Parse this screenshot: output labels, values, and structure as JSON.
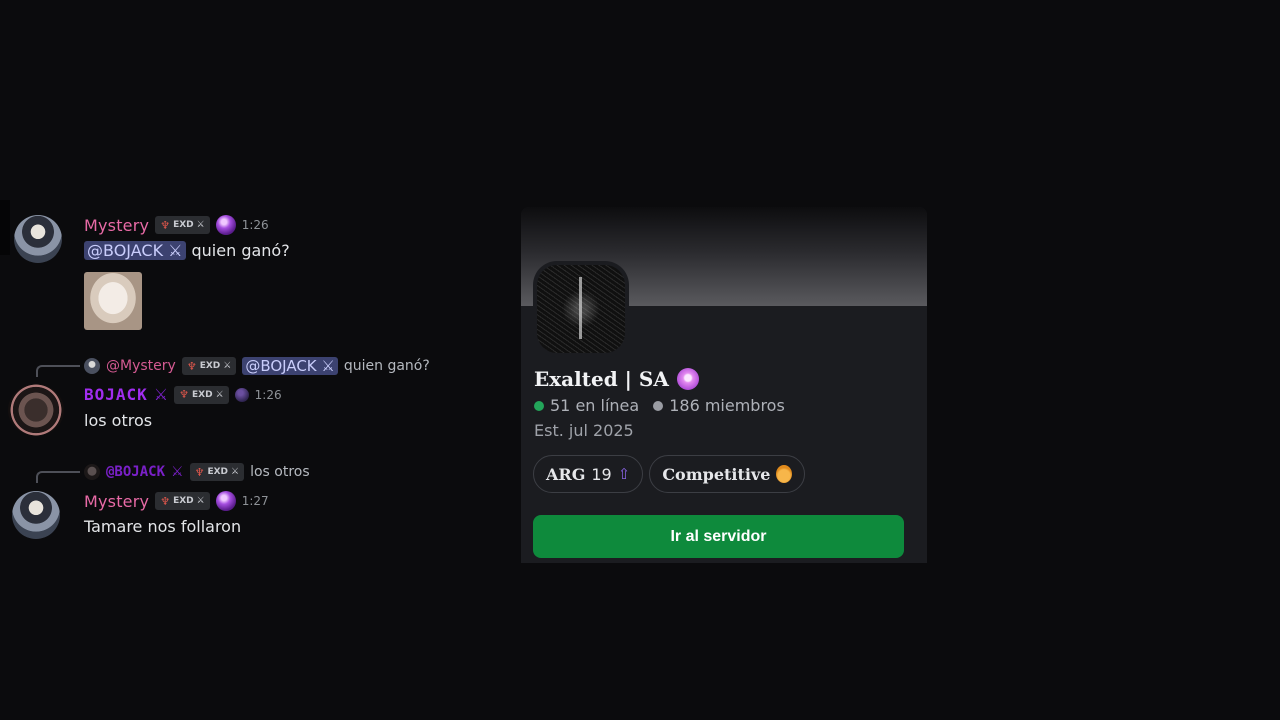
{
  "messages": [
    {
      "author": "Mystery",
      "role_tag": "EXD",
      "time": "1:26",
      "mention": "@BOJACK",
      "text": "quien ganó?"
    },
    {
      "reply": {
        "author": "@Mystery",
        "role_tag": "EXD",
        "mention": "@BOJACK",
        "text": "quien ganó?"
      },
      "author": "BOJACK",
      "role_tag": "EXD",
      "time": "1:26",
      "text": "los otros"
    },
    {
      "reply": {
        "author": "@BOJACK",
        "role_tag": "EXD",
        "text": "los otros"
      },
      "author": "Mystery",
      "role_tag": "EXD",
      "time": "1:27",
      "text": "Tamare nos follaron"
    }
  ],
  "server_card": {
    "name": "Exalted | SA",
    "online": "51 en línea",
    "members": "186 miembros",
    "established": "Est. jul 2025",
    "chips": [
      {
        "label": "ARG",
        "number": "19",
        "icon": "boost-up-icon"
      },
      {
        "label": "Competitive",
        "icon": "medal-icon"
      }
    ],
    "join_label": "Ir al servidor",
    "colors": {
      "join": "#0e8a3c",
      "online": "#23a55a"
    }
  }
}
